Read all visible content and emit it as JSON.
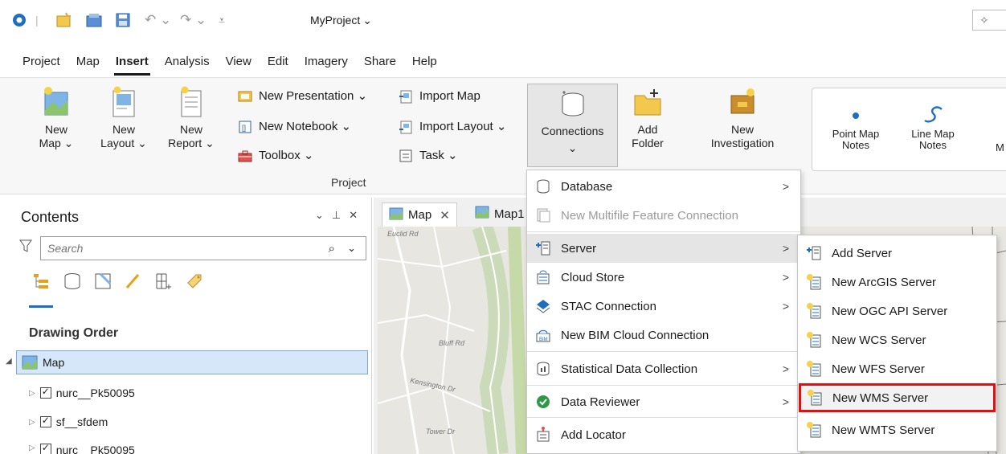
{
  "app": {
    "project_name": "MyProject"
  },
  "tabs": [
    "Project",
    "Map",
    "Insert",
    "Analysis",
    "View",
    "Edit",
    "Imagery",
    "Share",
    "Help"
  ],
  "ribbon": {
    "new_map": [
      "New",
      "Map ⌄"
    ],
    "new_layout": [
      "New",
      "Layout ⌄"
    ],
    "new_report": [
      "New",
      "Report ⌄"
    ],
    "new_presentation": "New Presentation  ⌄",
    "new_notebook": "New Notebook  ⌄",
    "toolbox": "Toolbox ⌄",
    "import_map": "Import Map",
    "import_layout": "Import Layout ⌄",
    "task": "Task ⌄",
    "connections": [
      "Connections",
      "⌄"
    ],
    "add_folder": [
      "Add",
      "Folder"
    ],
    "new_investigation": [
      "New",
      "Investigation"
    ],
    "point_map_notes": [
      "Point Map",
      "Notes"
    ],
    "line_map_notes": [
      "Line Map",
      "Notes"
    ],
    "group_label": "Project"
  },
  "contents": {
    "title": "Contents",
    "search_placeholder": "Search",
    "drawing_order": "Drawing Order",
    "layers": [
      "Map",
      "nurc__Pk50095",
      "sf__sfdem",
      "nurc__Pk50095"
    ]
  },
  "map_tabs": [
    "Map",
    "Map1"
  ],
  "connections_menu": [
    {
      "label": "Database",
      "arrow": true,
      "disabled": false
    },
    {
      "label": "New Multifile Feature Connection",
      "arrow": false,
      "disabled": true
    },
    {
      "label": "Server",
      "arrow": true,
      "disabled": false,
      "hover": true
    },
    {
      "label": "Cloud Store",
      "arrow": true,
      "disabled": false
    },
    {
      "label": "STAC Connection",
      "arrow": true,
      "disabled": false
    },
    {
      "label": "New BIM Cloud Connection",
      "arrow": false,
      "disabled": false
    },
    {
      "label": "Statistical Data Collection",
      "arrow": true,
      "disabled": false
    },
    {
      "label": "Data Reviewer",
      "arrow": true,
      "disabled": false
    },
    {
      "label": "Add Locator",
      "arrow": false,
      "disabled": false
    }
  ],
  "server_menu": [
    {
      "label": "Add Server"
    },
    {
      "label": "New ArcGIS Server"
    },
    {
      "label": "New OGC API Server"
    },
    {
      "label": "New WCS Server"
    },
    {
      "label": "New WFS Server"
    },
    {
      "label": "New WMS Server",
      "highlighted": true
    },
    {
      "label": "New WMTS Server"
    }
  ],
  "map_labels": [
    "Euclid Rd",
    "Kensington Dr",
    "Bluff Rd",
    "Tower Dr"
  ],
  "colors": {
    "highlight_box": "#e01010",
    "accent_blue": "#1f6fc1"
  }
}
